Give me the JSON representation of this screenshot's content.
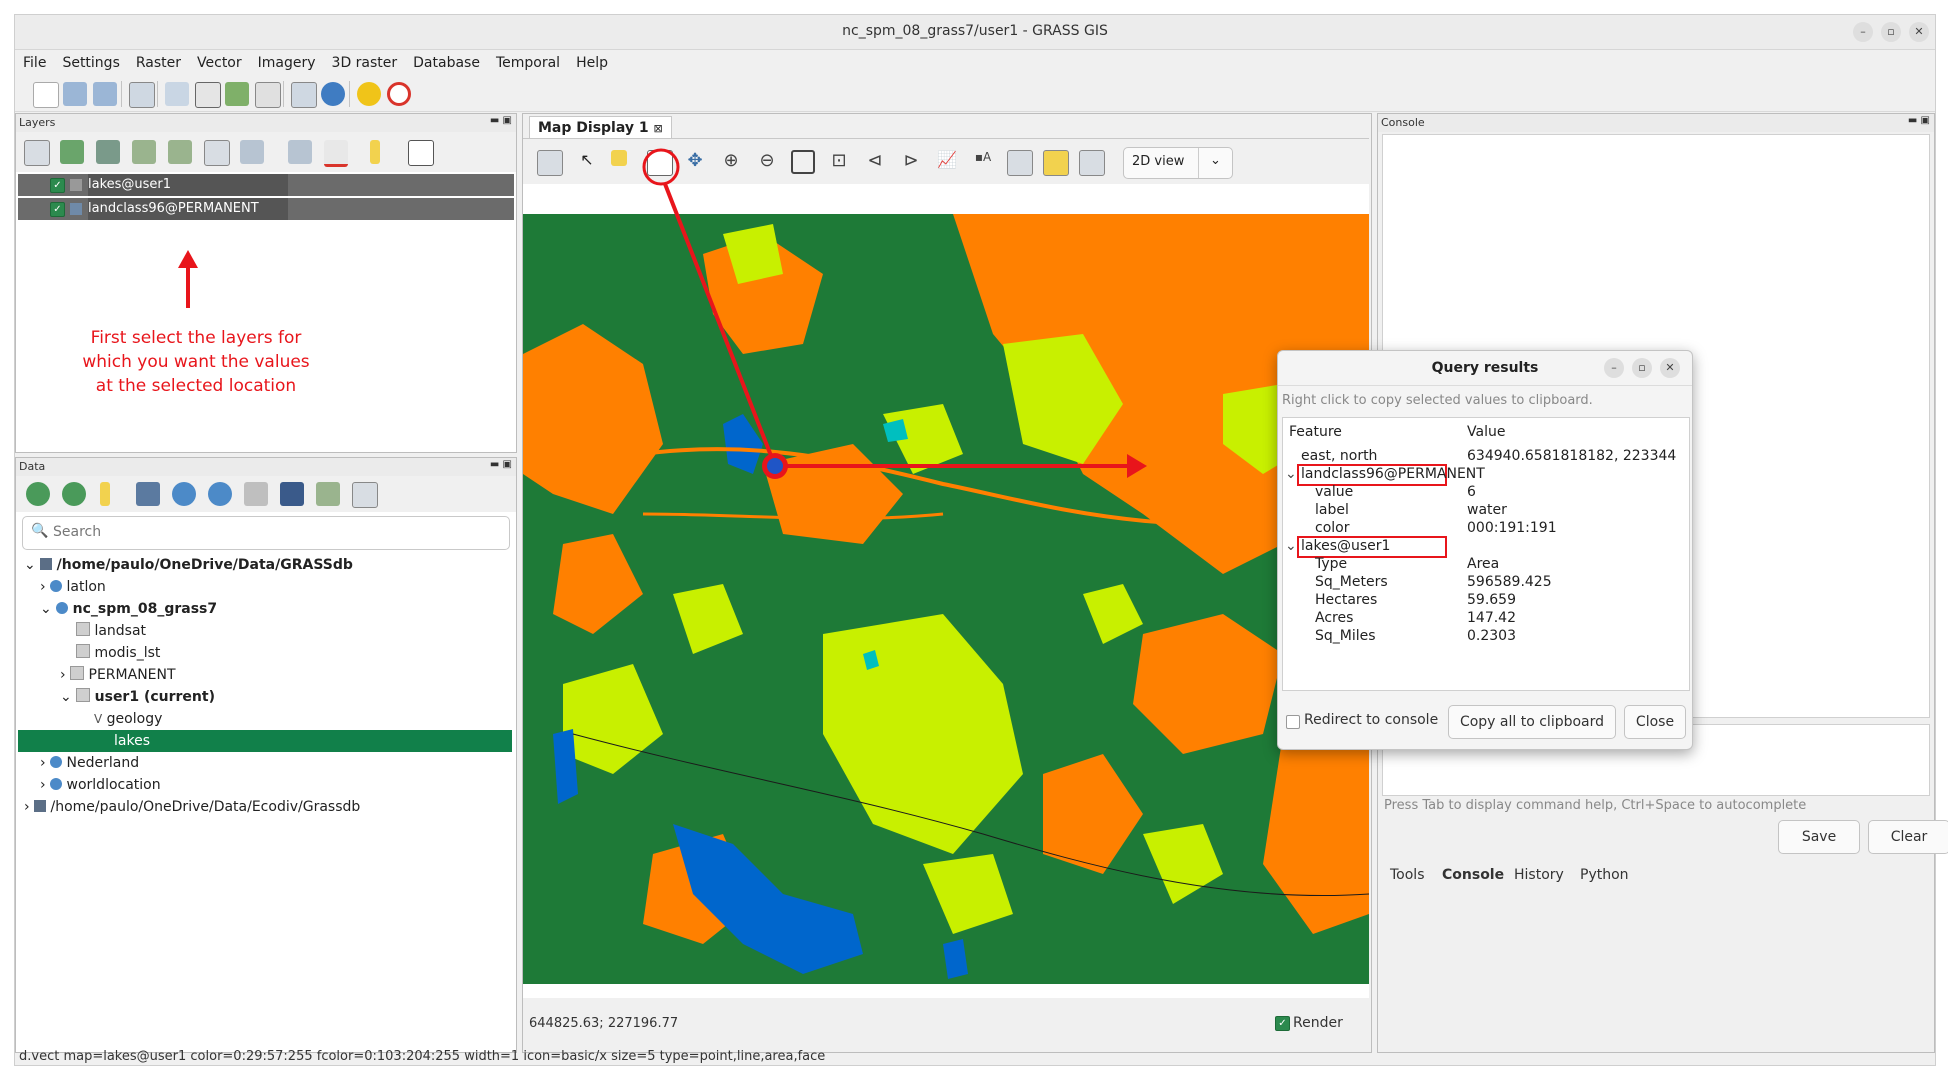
{
  "window": {
    "title": "nc_spm_08_grass7/user1 - GRASS GIS",
    "controls": [
      "–",
      "▫",
      "✕"
    ]
  },
  "menu": [
    "File",
    "Settings",
    "Raster",
    "Vector",
    "Imagery",
    "3D raster",
    "Database",
    "Temporal",
    "Help"
  ],
  "layers_panel": {
    "title": "Layers",
    "items": [
      {
        "name": "lakes@user1",
        "checked": true,
        "icon": "vector-layer-icon"
      },
      {
        "name": "landclass96@PERMANENT",
        "checked": true,
        "icon": "raster-layer-icon"
      }
    ],
    "annotation": "First select the layers  for\nwhich  you want the  values\nat the selected location"
  },
  "data_panel": {
    "title": "Data",
    "search_placeholder": "Search",
    "tree": [
      {
        "label": "/home/paulo/OneDrive/Data/GRASSdb",
        "bold": true,
        "icon": "database-icon"
      },
      {
        "label": "latlon",
        "icon": "globe-icon"
      },
      {
        "label": "nc_spm_08_grass7",
        "bold": true,
        "icon": "globe-icon"
      },
      {
        "label": "landsat",
        "icon": "mapset-icon"
      },
      {
        "label": "modis_lst",
        "icon": "mapset-icon"
      },
      {
        "label": "PERMANENT",
        "icon": "mapset-icon"
      },
      {
        "label": "user1  (current)",
        "bold": true,
        "icon": "mapset-icon"
      },
      {
        "label": "geology",
        "icon": "vector-icon"
      },
      {
        "label": "lakes",
        "selected": true
      },
      {
        "label": "Nederland",
        "icon": "globe-icon"
      },
      {
        "label": "worldlocation",
        "icon": "globe-icon"
      },
      {
        "label": "/home/paulo/OneDrive/Data/Ecodiv/Grassdb",
        "icon": "database-icon"
      }
    ]
  },
  "map_display": {
    "tab_label": "Map Display 1",
    "view_mode": "2D view",
    "coordinates": "644825.63; 227196.77",
    "render_label": "Render",
    "render_checked": true,
    "colors": {
      "forest": "#1e7a37",
      "agriculture": "#ff8000",
      "grass": "#c8f000",
      "water": "#0066cc"
    }
  },
  "console_panel": {
    "title": "Console",
    "hint": "Press Tab to display command help, Ctrl+Space to autocomplete",
    "save_label": "Save",
    "clear_label": "Clear",
    "tabs": [
      "Tools",
      "Console",
      "History",
      "Python"
    ],
    "active_tab": "Console"
  },
  "query_dialog": {
    "title": "Query results",
    "hint": "Right click to copy selected values to clipboard.",
    "col_feature": "Feature",
    "col_value": "Value",
    "rows": [
      {
        "feature": "east, north",
        "value": "634940.6581818182, 223344"
      },
      {
        "feature": "landclass96@PERMANENT",
        "value": "",
        "group": true
      },
      {
        "feature": "value",
        "value": "6"
      },
      {
        "feature": "label",
        "value": "water"
      },
      {
        "feature": "color",
        "value": "000:191:191"
      },
      {
        "feature": "lakes@user1",
        "value": "",
        "group": true
      },
      {
        "feature": "Type",
        "value": "Area"
      },
      {
        "feature": "Sq_Meters",
        "value": "596589.425"
      },
      {
        "feature": "Hectares",
        "value": "59.659"
      },
      {
        "feature": "Acres",
        "value": "147.42"
      },
      {
        "feature": "Sq_Miles",
        "value": "0.2303"
      }
    ],
    "redirect_label": "Redirect to console",
    "copy_label": "Copy all to clipboard",
    "close_label": "Close"
  },
  "status_bar": "d.vect map=lakes@user1 color=0:29:57:255 fcolor=0:103:204:255 width=1 icon=basic/x size=5 type=point,line,area,face"
}
